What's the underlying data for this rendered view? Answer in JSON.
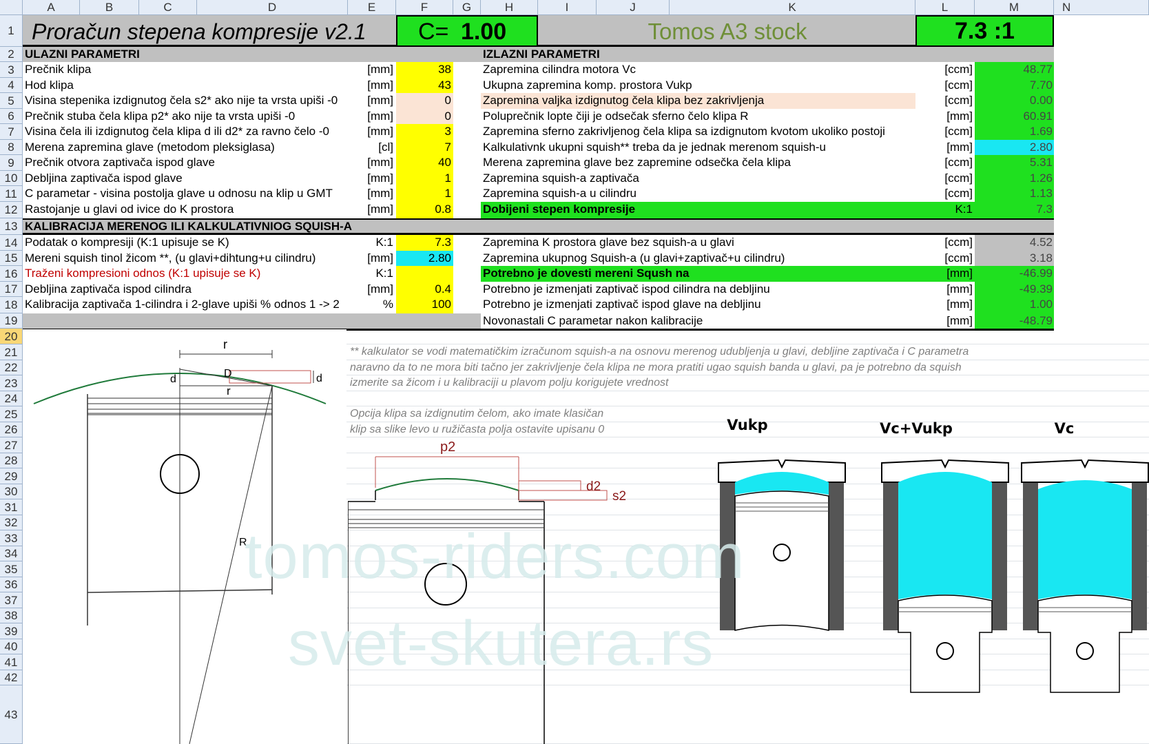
{
  "columns": [
    "A",
    "B",
    "C",
    "D",
    "E",
    "F",
    "G",
    "H",
    "I",
    "J",
    "K",
    "L",
    "M",
    "N"
  ],
  "rows": [
    "1",
    "2",
    "3",
    "4",
    "5",
    "6",
    "7",
    "8",
    "9",
    "10",
    "11",
    "12",
    "13",
    "14",
    "15",
    "16",
    "17",
    "18",
    "19",
    "20",
    "21",
    "22",
    "23",
    "24",
    "25",
    "26",
    "27",
    "28",
    "29",
    "30",
    "31",
    "32",
    "33",
    "34",
    "35",
    "36",
    "37",
    "38",
    "39",
    "40",
    "41",
    "42",
    "43"
  ],
  "selected_row": "20",
  "header": {
    "title": "Proračun stepena kompresije v2.1",
    "c_label": "C=",
    "c_value": "1.00",
    "model": "Tomos A3 stock",
    "ratio": "7.3 :1"
  },
  "input_section": {
    "title": "ULAZNI PARAMETRI",
    "rows": [
      {
        "label": "Prečnik klipa",
        "unit": "[mm]",
        "value": "38"
      },
      {
        "label": "Hod klipa",
        "unit": "[mm]",
        "value": "43"
      },
      {
        "label": "Visina stepenika izdignutog čela s2* ako nije ta vrsta upiši -0",
        "unit": "[mm]",
        "value": "0"
      },
      {
        "label": "Prečnik stuba čela klipa p2* ako nije ta vrsta upiši -0",
        "unit": "[mm]",
        "value": "0"
      },
      {
        "label": "Visina čela ili izdignutog čela klipa d ili d2* za ravno čelo -0",
        "unit": "[mm]",
        "value": "3"
      },
      {
        "label": "Merena zapremina glave (metodom pleksiglasa)",
        "unit": "[cl]",
        "value": "7"
      },
      {
        "label": "Prečnik otvora zaptivača ispod glave",
        "unit": "[mm]",
        "value": "40"
      },
      {
        "label": "Debljina zaptivača ispod glave",
        "unit": "[mm]",
        "value": "1"
      },
      {
        "label": "C parametar - visina postolja glave u odnosu na klip u GMT",
        "unit": "[mm]",
        "value": "1"
      },
      {
        "label": "Rastojanje u glavi od ivice do K prostora",
        "unit": "[mm]",
        "value": "0.8"
      }
    ]
  },
  "output_section": {
    "title": "IZLAZNI PARAMETRI",
    "rows": [
      {
        "label": "Zapremina cilindra motora Vc",
        "unit": "[ccm]",
        "value": "48.77"
      },
      {
        "label": "Ukupna zapremina komp. prostora Vukp",
        "unit": "[ccm]",
        "value": "7.70"
      },
      {
        "label": "Zapremina valjka izdignutog čela klipa bez zakrivljenja",
        "unit": "[ccm]",
        "value": "0.00"
      },
      {
        "label": "Poluprečnik lopte čiji je odsečak sferno čelo klipa R",
        "unit": "[mm]",
        "value": "60.91"
      },
      {
        "label": "Zapremina sferno zakrivljenog čela klipa sa izdignutom kvotom ukoliko postoji",
        "unit": "[ccm]",
        "value": "1.69"
      },
      {
        "label": "Kalkulativnk ukupni squish**  treba da je jednak merenom squish-u",
        "unit": "[mm]",
        "value": "2.80"
      },
      {
        "label": "Merena zapremina glave bez zapremine odsečka čela klipa",
        "unit": "[ccm]",
        "value": "5.31"
      },
      {
        "label": "Zapremina squish-a zaptivača",
        "unit": "[ccm]",
        "value": "1.26"
      },
      {
        "label": "Zapremina squish-a u cilindru",
        "unit": "[ccm]",
        "value": "1.13"
      },
      {
        "label": "Dobijeni stepen kompresije",
        "unit": "K:1",
        "value": "7.3"
      }
    ]
  },
  "calib_section": {
    "title": "KALIBRACIJA MERENOG ILI KALKULATIVNIOG SQUISH-A",
    "left_rows": [
      {
        "label": "Podatak o kompresiji (K:1 upisuje se K)",
        "unit": "K:1",
        "value": "7.3"
      },
      {
        "label": "Mereni squish tinol žicom **, (u glavi+dihtung+u cilindru)",
        "unit": "[mm]",
        "value": "2.80"
      },
      {
        "label": "Traženi kompresioni odnos (K:1 upisuje se K)",
        "unit": "K:1",
        "value": ""
      },
      {
        "label": "Debljina zaptivača ispod cilindra",
        "unit": "[mm]",
        "value": "0.4"
      },
      {
        "label": "Kalibracija zaptivača 1-cilindra i 2-glave upiši % odnos 1 -> 2",
        "unit": "%",
        "value": "100"
      }
    ],
    "right_rows": [
      {
        "label": "Zapremina K prostora glave bez squish-a u glavi",
        "unit": "[ccm]",
        "value": "4.52"
      },
      {
        "label": "Zapremina ukupnog Squish-a (u glavi+zaptivač+u cilindru)",
        "unit": "[ccm]",
        "value": "3.18"
      },
      {
        "label": "Potrebno je dovesti mereni Sqush na",
        "unit": "[mm]",
        "value": "-46.99"
      },
      {
        "label": "Potrebno je izmenjati zaptivač ispod cilindra na debljinu",
        "unit": "[mm]",
        "value": "-49.39"
      },
      {
        "label": "Potrebno je izmenjati zaptivač ispod glave na debljinu",
        "unit": "[mm]",
        "value": "1.00"
      },
      {
        "label": "Novonastali C parametar nakon kalibracije",
        "unit": "[mm]",
        "value": "-48.79"
      }
    ]
  },
  "notes": {
    "squish_note": [
      "** kalkulator se vodi matematičkim izračunom squish-a na osnovu merenog udubljenja u glavi, debljine zaptivača i C parametra",
      "naravno da to ne mora biti tačno jer zakrivljenje čela klipa ne mora pratiti ugao squish banda u glavi, pa je potrebno da squish",
      "izmerite sa žicom i u kalibraciji u plavom polju korigujete vrednost"
    ],
    "piston_note": [
      "Opcija klipa sa izdignutim čelom, ako imate klasičan",
      "klip sa slike levo u ružičasta polja ostavite upisanu 0"
    ]
  },
  "diagram_labels": {
    "r_top": "r",
    "d_left": "d",
    "D": "D",
    "d_right": "d",
    "r_small": "r",
    "R": "R",
    "p2": "p2",
    "d2": "d2",
    "s2": "s2",
    "vukp": "Vukp",
    "vcvukp": "Vc+Vukp",
    "vc": "Vc"
  },
  "watermark": [
    "tomos-riders.com",
    "svet-skutera.rs"
  ],
  "colors": {
    "yellow": "#ffff00",
    "green": "#1fe01f",
    "cyan": "#19e7f2",
    "peach": "#fbe4d5",
    "gray": "#c0c0c0"
  }
}
